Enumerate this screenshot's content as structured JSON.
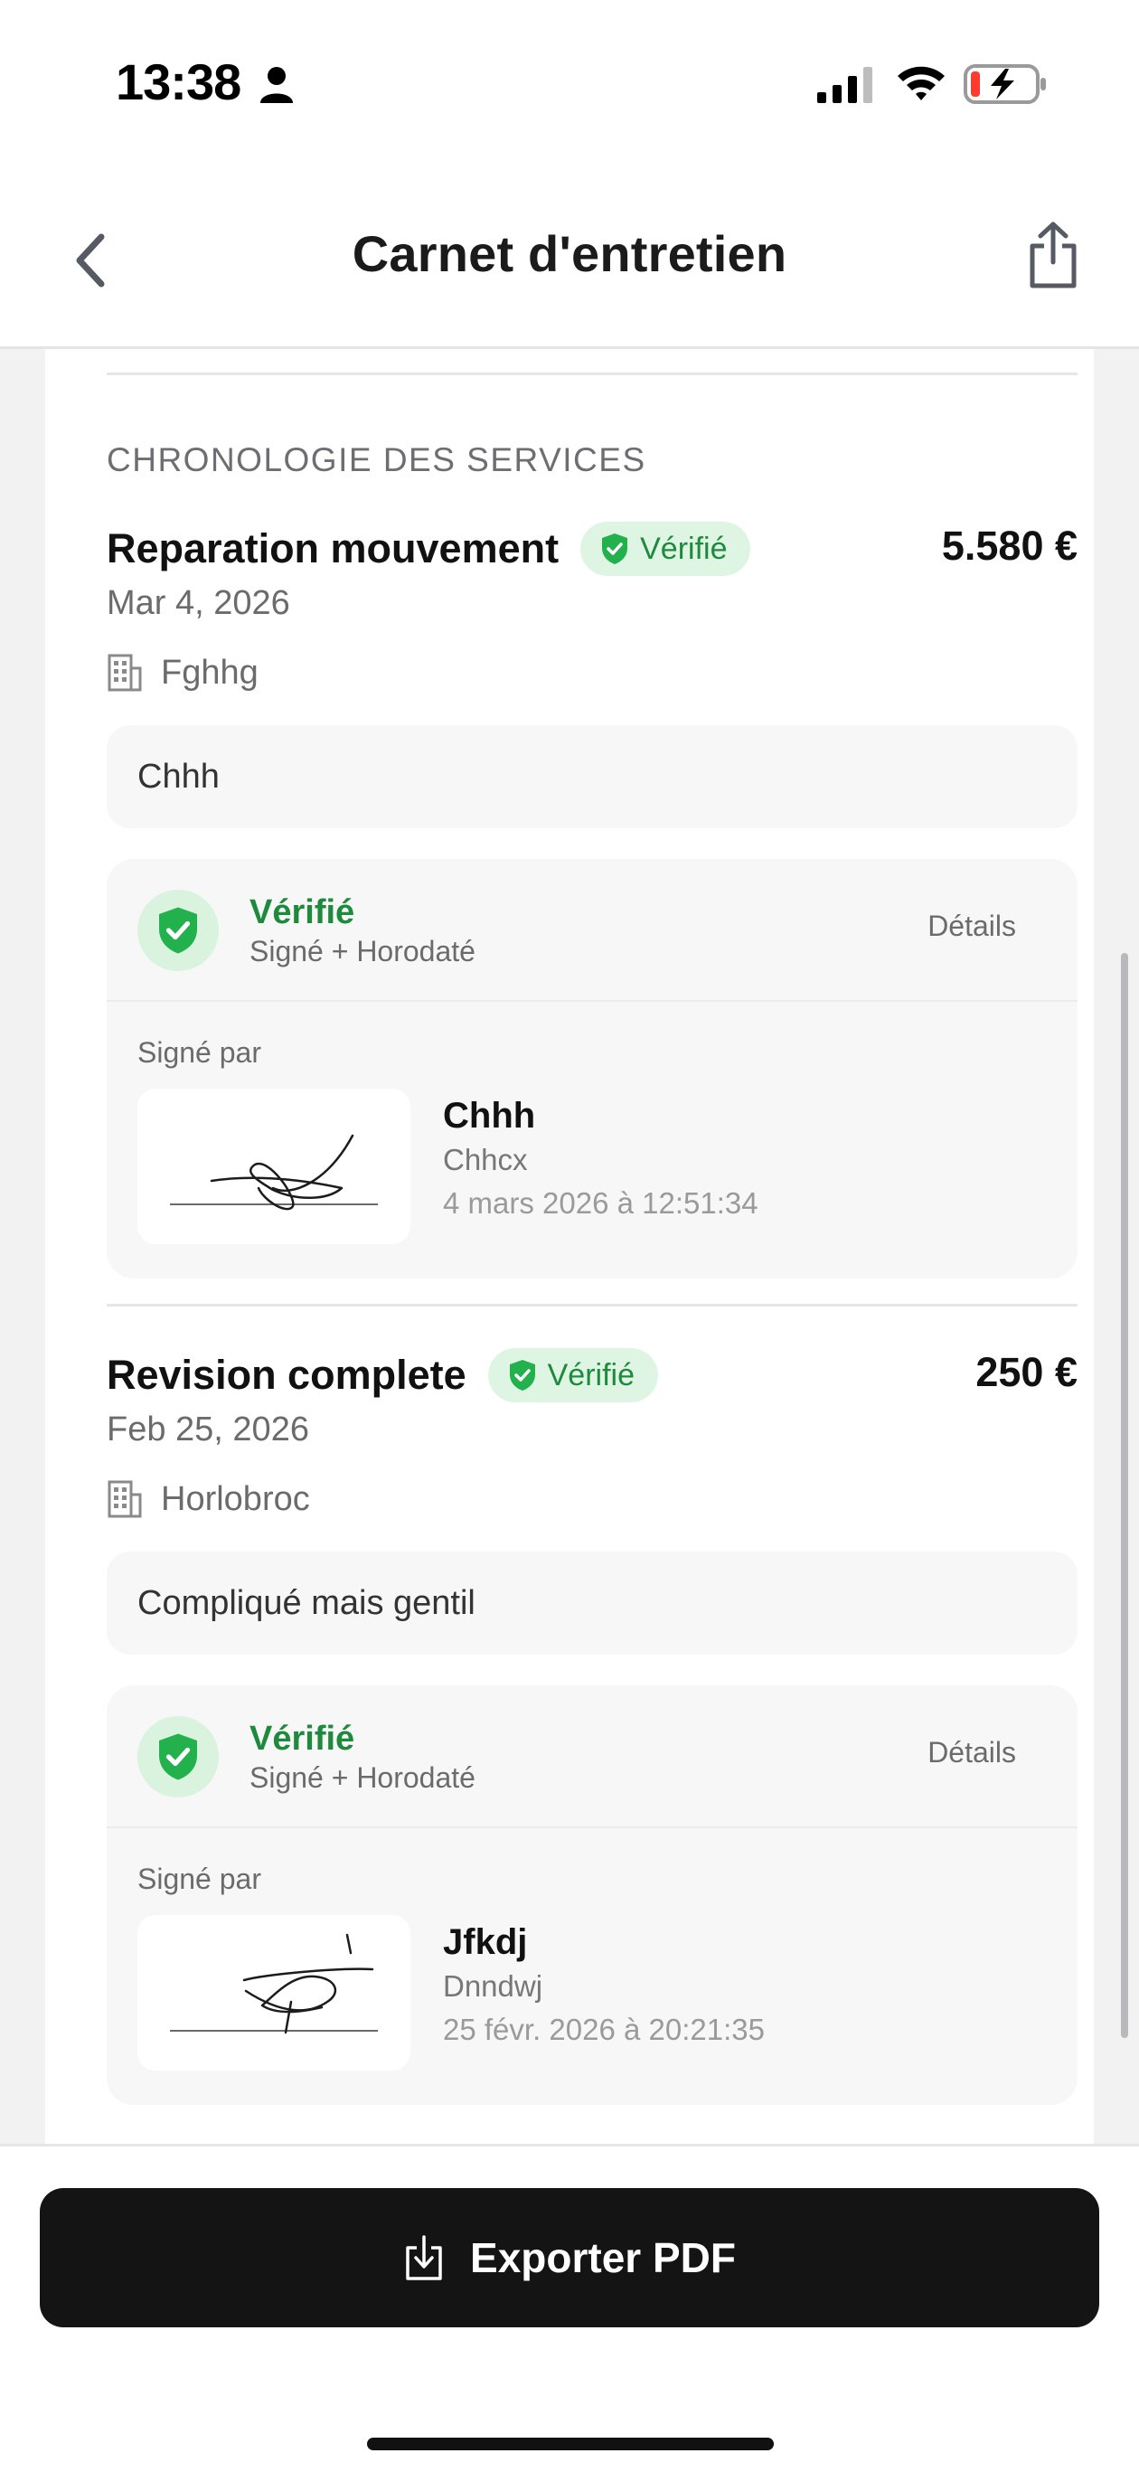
{
  "status_bar": {
    "time": "13:38"
  },
  "header": {
    "title": "Carnet d'entretien"
  },
  "section": {
    "title": "CHRONOLOGIE DES SERVICES"
  },
  "services": [
    {
      "title": "Reparation mouvement",
      "badge": "Vérifié",
      "price": "5.580 €",
      "date": "Mar 4, 2026",
      "workshop": "Fghhg",
      "notes": "Chhh",
      "verification": {
        "title": "Vérifié",
        "subtitle": "Signé + Horodaté",
        "details_label": "Détails",
        "signed_by_label": "Signé par",
        "signer_name": "Chhh",
        "signer_role": "Chhcx",
        "signed_at": "4 mars 2026 à 12:51:34"
      }
    },
    {
      "title": "Revision complete",
      "badge": "Vérifié",
      "price": "250 €",
      "date": "Feb 25, 2026",
      "workshop": "Horlobroc",
      "notes": "Compliqué mais gentil",
      "verification": {
        "title": "Vérifié",
        "subtitle": "Signé + Horodaté",
        "details_label": "Détails",
        "signed_by_label": "Signé par",
        "signer_name": "Jfkdj",
        "signer_role": "Dnndwj",
        "signed_at": "25 févr. 2026 à 20:21:35"
      }
    }
  ],
  "footer": {
    "export_label": "Exporter PDF"
  },
  "colors": {
    "verified_green": "#1e8a3c",
    "badge_bg": "#dff5e4",
    "button_dark": "#141414"
  },
  "icons": {
    "back": "chevron-left-icon",
    "share": "share-icon",
    "building": "building-icon",
    "shield": "shield-check-icon",
    "download": "download-icon"
  }
}
